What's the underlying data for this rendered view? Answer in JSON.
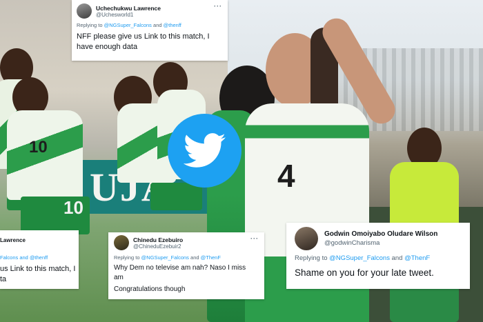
{
  "tweet_top": {
    "name": "Uchechukwu Lawrence",
    "handle": "@Uchesworld1",
    "replying_prefix": "Replying to",
    "replying_to_1": "@NGSuper_Falcons",
    "replying_and": "and",
    "replying_to_2": "@thenff",
    "more": "···",
    "text": "NFF please give us Link to this match, I have enough data"
  },
  "tweet_left_cropped": {
    "name": "Lawrence",
    "replying": "Falcons and @thenff",
    "text_line1": "us Link to this match, I",
    "text_line2": "ta"
  },
  "tweet_middle": {
    "name": "Chinedu Ezebuiro",
    "handle": "@ChineduEzebuir2",
    "replying_prefix": "Replying to",
    "replying_to_1": "@NGSuper_Falcons",
    "replying_and": "and",
    "replying_to_2": "@ThenF",
    "more": "···",
    "text_line1": "Why Dem no televise am nah? Naso I miss",
    "text_line2": "am",
    "text_line3": "Congratulations though"
  },
  "tweet_right": {
    "name": "Godwin Omoiyabo Oludare Wilson",
    "handle": "@godwinCharisma",
    "replying_prefix": "Replying to",
    "replying_to_1": "@NGSuper_Falcons",
    "replying_and": "and",
    "replying_to_2": "@ThenF",
    "text": "Shame on you for your late tweet."
  },
  "background": {
    "board_text": "UJA",
    "jersey_numbers": [
      "10",
      "10",
      "4"
    ]
  },
  "colors": {
    "twitter_blue": "#1da1f2",
    "link_blue": "#1d9bf0",
    "kit_green": "#1f8a3f"
  },
  "icons": [
    "twitter-bird-icon",
    "avatar-icon",
    "more-options-icon"
  ]
}
